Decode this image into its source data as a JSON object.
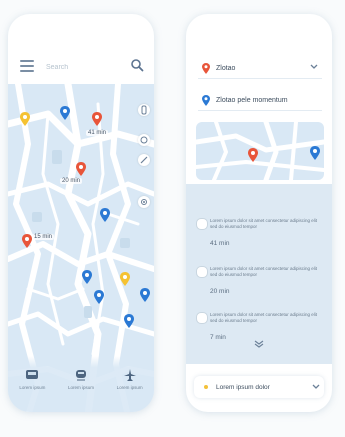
{
  "left_screen": {
    "search": {
      "placeholder": "Search"
    },
    "pins": [
      {
        "color": "#f5c232",
        "label": ""
      },
      {
        "color": "#2b79d4",
        "label": ""
      },
      {
        "color": "#e8553a",
        "label": "41 min"
      },
      {
        "color": "#e8553a",
        "label": "20 min"
      },
      {
        "color": "#2b79d4",
        "label": ""
      },
      {
        "color": "#e8553a",
        "label": "15 min"
      },
      {
        "color": "#2b79d4",
        "label": ""
      },
      {
        "color": "#2b79d4",
        "label": ""
      },
      {
        "color": "#f5c232",
        "label": ""
      },
      {
        "color": "#2b79d4",
        "label": ""
      },
      {
        "color": "#2b79d4",
        "label": ""
      }
    ],
    "bottom_nav": [
      {
        "label": "Lorem ipsum",
        "icon": "bus-icon"
      },
      {
        "label": "Lorem ipsum",
        "icon": "train-icon"
      },
      {
        "label": "Lorem ipsum",
        "icon": "plane-icon"
      }
    ]
  },
  "right_screen": {
    "origin": {
      "text": "Zlotao",
      "icon": "red-pin-icon"
    },
    "destination": {
      "text": "Zlotao pele momentum",
      "icon": "blue-pin-icon"
    },
    "routes": [
      {
        "description": "Lorem ipsum dolor sit amet consectetur adipiscing elit sed do eiusmod tempor",
        "time": "41 min"
      },
      {
        "description": "Lorem ipsum dolor sit amet consectetur adipiscing elit sed do eiusmod tempor",
        "time": "20 min"
      },
      {
        "description": "Lorem ipsum dolor sit amet consectetur adipiscing elit sed do eiusmod tempor",
        "time": "7 min"
      }
    ],
    "bottom_field": {
      "text": "Lorem ipsum dolor"
    }
  },
  "colors": {
    "accent_blue": "#2b79d4",
    "accent_red": "#e8553a",
    "accent_yellow": "#f5c232",
    "map_water": "#d9e8f5",
    "map_road": "#ffffff",
    "panel": "#dde9f3"
  }
}
